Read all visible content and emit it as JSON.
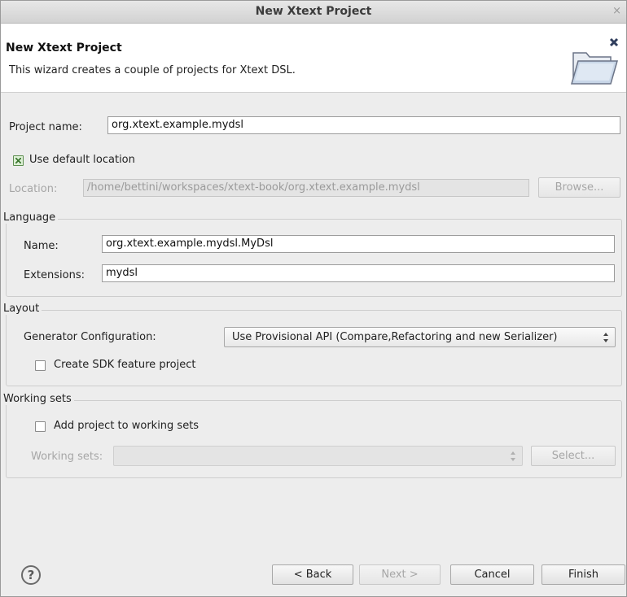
{
  "window": {
    "title": "New Xtext Project",
    "close_glyph": "×"
  },
  "header": {
    "title": "New Xtext Project",
    "description": "This wizard creates a couple of projects for Xtext DSL.",
    "icon": "open-folder-icon"
  },
  "project": {
    "name_label": "Project name:",
    "name_value": "org.xtext.example.mydsl",
    "use_default_location_label": "Use default location",
    "use_default_location_checked": true,
    "location_label": "Location:",
    "location_value": "/home/bettini/workspaces/xtext-book/org.xtext.example.mydsl",
    "browse_label": "Browse..."
  },
  "language": {
    "group_label": "Language",
    "name_label": "Name:",
    "name_value": "org.xtext.example.mydsl.MyDsl",
    "extensions_label": "Extensions:",
    "extensions_value": "mydsl"
  },
  "layout": {
    "group_label": "Layout",
    "generator_label": "Generator Configuration:",
    "generator_value": "Use Provisional API (Compare,Refactoring and new Serializer)",
    "sdk_feature_label": "Create SDK feature project",
    "sdk_feature_checked": false
  },
  "working_sets": {
    "group_label": "Working sets",
    "add_label": "Add project to working sets",
    "add_checked": false,
    "sets_label": "Working sets:",
    "sets_value": "",
    "select_label": "Select..."
  },
  "footer": {
    "help_glyph": "?",
    "back_label": "< Back",
    "next_label": "Next >",
    "cancel_label": "Cancel",
    "finish_label": "Finish"
  },
  "colors": {
    "window_bg": "#ededed",
    "header_bg": "#ffffff",
    "check_accent": "#3f7a33"
  }
}
